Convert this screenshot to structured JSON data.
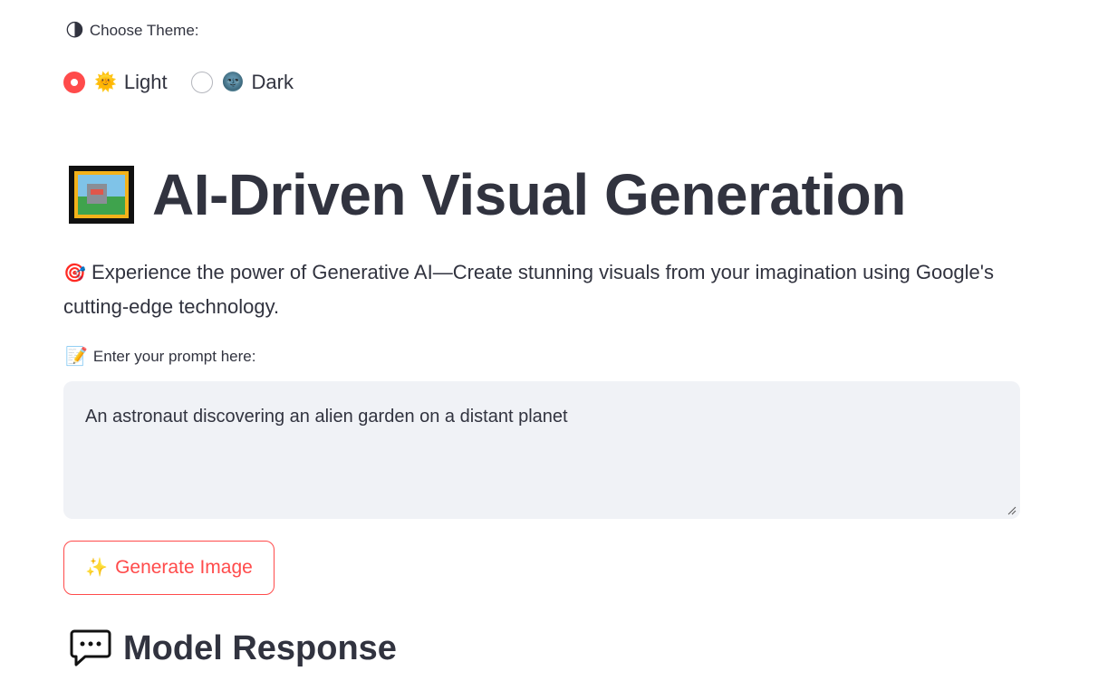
{
  "theme": {
    "label_icon": "half-moon-icon",
    "label": "Choose Theme:",
    "options": [
      {
        "icon": "sun-icon",
        "label": "Light",
        "selected": true
      },
      {
        "icon": "new-moon-icon",
        "label": "Dark",
        "selected": false
      }
    ]
  },
  "header": {
    "icon": "framed-picture-icon",
    "title": "AI-Driven Visual Generation"
  },
  "intro": {
    "icon": "target-icon",
    "text": "Experience the power of Generative AI—Create stunning visuals from your imagination using Google's cutting-edge technology."
  },
  "prompt": {
    "label_icon": "memo-icon",
    "label": "Enter your prompt here:",
    "value": "An astronaut discovering an alien garden on a distant planet"
  },
  "generate_button": {
    "icon": "sparkles-icon",
    "label": "Generate Image"
  },
  "response": {
    "icon": "speech-bubble-icon",
    "heading": "Model Response"
  },
  "colors": {
    "accent": "#ff4b4b",
    "text": "#31333f",
    "input_bg": "#f0f2f6"
  }
}
